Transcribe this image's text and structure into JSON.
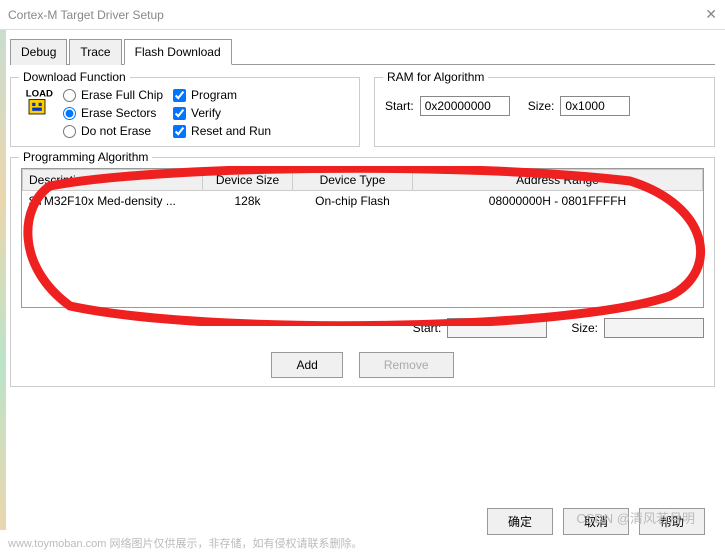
{
  "window": {
    "title": "Cortex-M Target Driver Setup"
  },
  "tabs": {
    "debug": "Debug",
    "trace": "Trace",
    "flash": "Flash Download"
  },
  "download_function": {
    "title": "Download Function",
    "load_label": "LOAD",
    "erase_full": "Erase Full Chip",
    "erase_sectors": "Erase Sectors",
    "do_not_erase": "Do not Erase",
    "program": "Program",
    "verify": "Verify",
    "reset_run": "Reset and Run"
  },
  "ram": {
    "title": "RAM for Algorithm",
    "start_label": "Start:",
    "start_value": "0x20000000",
    "size_label": "Size:",
    "size_value": "0x1000"
  },
  "prog_algo": {
    "title": "Programming Algorithm",
    "cols": {
      "desc": "Description",
      "devsize": "Device Size",
      "devtype": "Device Type",
      "addr": "Address Range"
    },
    "rows": [
      {
        "desc": "STM32F10x Med-density ...",
        "devsize": "128k",
        "devtype": "On-chip Flash",
        "addr": "08000000H - 0801FFFFH"
      }
    ],
    "start_label": "Start:",
    "start_value": "",
    "size_label": "Size:",
    "size_value": "",
    "add": "Add",
    "remove": "Remove"
  },
  "buttons": {
    "ok": "确定",
    "cancel": "取消",
    "help": "帮助"
  },
  "watermark": {
    "left": "www.toymoban.com  网络图片仅供展示，非存储，如有侵权请联系删除。",
    "right": "CSDN @清风若月明"
  }
}
